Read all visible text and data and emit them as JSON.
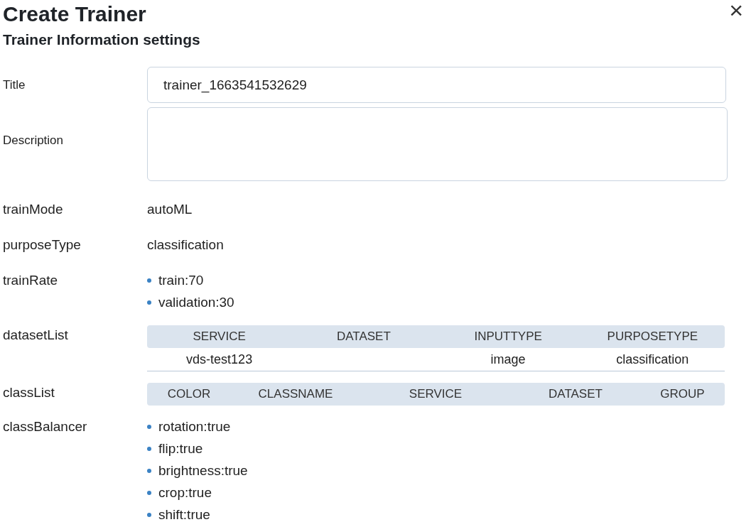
{
  "dialog": {
    "title": "Create Trainer",
    "subtitle": "Trainer Information settings",
    "close": "×"
  },
  "fields": [
    {
      "kind": "input",
      "label": "Title",
      "value": "trainer_1663541532629"
    },
    {
      "kind": "textarea",
      "label": "Description"
    },
    {
      "kind": "text",
      "label": "trainMode",
      "value": "autoML"
    },
    {
      "kind": "text",
      "label": "purposeType",
      "value": "classification"
    },
    {
      "kind": "list",
      "label": "trainRate",
      "items": [
        "train:70",
        "validation:30"
      ]
    },
    {
      "kind": "table",
      "label": "datasetList",
      "columns": [
        "SERVICE",
        "DATASET",
        "INPUTTYPE",
        "PURPOSETYPE"
      ],
      "rows": [
        [
          "vds-test123",
          null,
          "image",
          "classification"
        ]
      ]
    },
    {
      "kind": "table",
      "label": "classList",
      "columns": [
        "COLOR",
        "CLASSNAME",
        "SERVICE",
        "DATASET",
        "GROUP"
      ]
    },
    {
      "kind": "list",
      "label": "classBalancer",
      "items": [
        "rotation:true",
        "flip:true",
        "brightness:true",
        "crop:true",
        "shift:true"
      ]
    }
  ]
}
